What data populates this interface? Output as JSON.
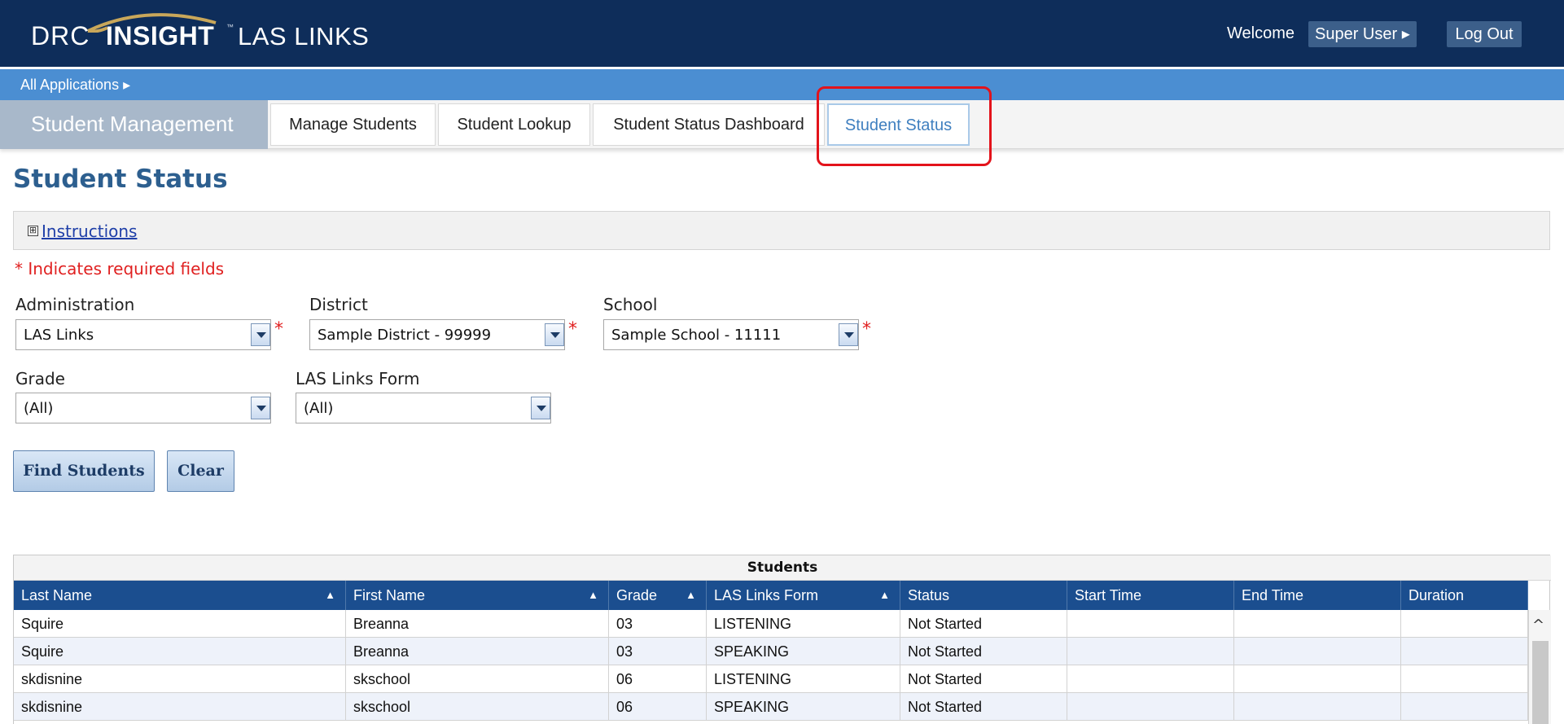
{
  "header": {
    "logo_left": "DRC",
    "logo_right": "INSIGHT",
    "logo_tm": "™",
    "app_name": "LAS LINKS",
    "welcome": "Welcome",
    "user_label": "Super User",
    "logout_label": "Log Out",
    "caret": "▸"
  },
  "apps_bar": {
    "label": "All Applications ▸"
  },
  "tabs": {
    "section": "Student Management",
    "items": [
      {
        "label": "Manage Students"
      },
      {
        "label": "Student Lookup"
      },
      {
        "label": "Student Status Dashboard"
      },
      {
        "label": "Student Status",
        "active": true
      }
    ]
  },
  "page": {
    "title": "Student Status",
    "instructions_toggle": "⊞",
    "instructions_label": "Instructions",
    "required_note": "* Indicates required fields",
    "required_star": "*"
  },
  "filters": {
    "administration": {
      "label": "Administration",
      "value": "LAS Links"
    },
    "district": {
      "label": "District",
      "value": "Sample District - 99999"
    },
    "school": {
      "label": "School",
      "value": "Sample School - 11111"
    },
    "grade": {
      "label": "Grade",
      "value": "(All)"
    },
    "form": {
      "label": "LAS Links Form",
      "value": "(All)"
    }
  },
  "buttons": {
    "find": "Find Students",
    "clear": "Clear"
  },
  "grid": {
    "caption": "Students",
    "sort_glyph": "▲",
    "columns": [
      {
        "label": "Last Name",
        "sortable": true
      },
      {
        "label": "First Name",
        "sortable": true
      },
      {
        "label": "Grade",
        "sortable": true
      },
      {
        "label": "LAS Links Form",
        "sortable": true
      },
      {
        "label": "Status",
        "sortable": false
      },
      {
        "label": "Start Time",
        "sortable": false
      },
      {
        "label": "End Time",
        "sortable": false
      },
      {
        "label": "Duration",
        "sortable": false
      }
    ],
    "rows": [
      [
        "Squire",
        "Breanna",
        "03",
        "LISTENING",
        "Not Started",
        "",
        "",
        ""
      ],
      [
        "Squire",
        "Breanna",
        "03",
        "SPEAKING",
        "Not Started",
        "",
        "",
        ""
      ],
      [
        "skdisnine",
        "skschool",
        "06",
        "LISTENING",
        "Not Started",
        "",
        "",
        ""
      ],
      [
        "skdisnine",
        "skschool",
        "06",
        "SPEAKING",
        "Not Started",
        "",
        "",
        ""
      ]
    ],
    "scroll_up": "^"
  },
  "colors": {
    "header_bg": "#0e2d5a",
    "apps_bar_bg": "#4b8ed2",
    "section_tab_bg": "#a8b8ca",
    "table_header_bg": "#1b4e8f",
    "title_color": "#2d5f8f",
    "required_color": "#e02020",
    "highlight_color": "#e3131b"
  }
}
